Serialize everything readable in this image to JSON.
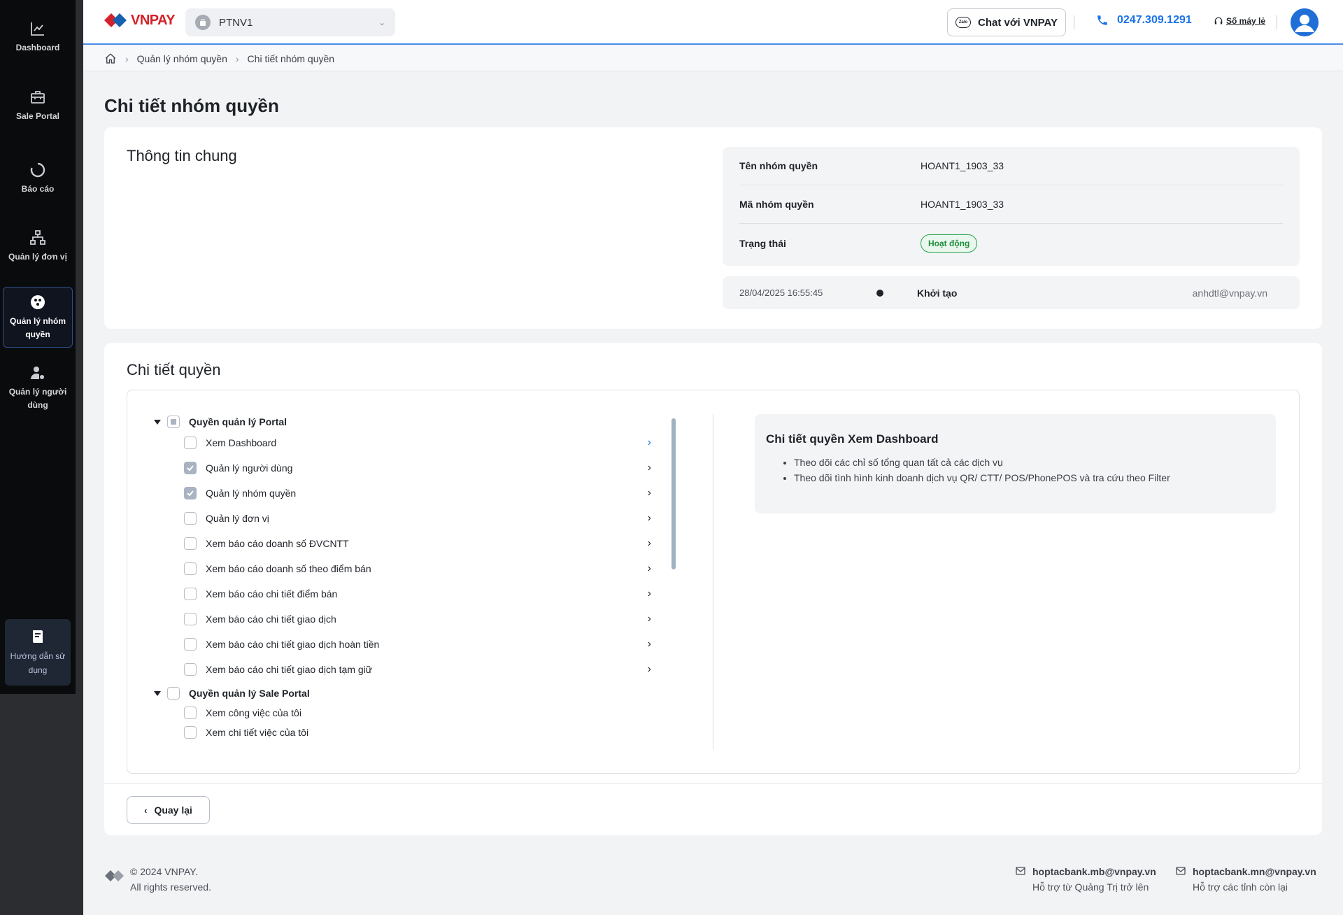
{
  "sidebar": {
    "items": [
      {
        "label": "Dashboard",
        "icon": "chart-line-icon"
      },
      {
        "label": "Sale Portal",
        "icon": "briefcase-icon"
      },
      {
        "label": "Báo cáo",
        "icon": "loading-circle-icon"
      },
      {
        "label": "Quản lý đơn vị",
        "icon": "hierarchy-icon"
      },
      {
        "label": "Quản lý nhóm quyền",
        "icon": "group-icon",
        "active": true
      },
      {
        "label": "Quản lý người dùng",
        "icon": "user-settings-icon"
      }
    ],
    "guide_label": "Hướng dẫn sử dụng"
  },
  "header": {
    "logo_text": "VNPAY",
    "merchant": "PTNV1",
    "chat_label": "Chat với VNPAY",
    "chat_badge": "Zalo",
    "hotline": "0247.309.1291",
    "retail_label": "Số máy lẻ"
  },
  "breadcrumb": {
    "items": [
      "Quản lý nhóm quyền",
      "Chi tiết nhóm quyền"
    ]
  },
  "page": {
    "title": "Chi tiết nhóm quyền"
  },
  "general": {
    "title": "Thông tin chung",
    "rows": [
      {
        "label": "Tên nhóm quyền",
        "value": "HOANT1_1903_33"
      },
      {
        "label": "Mã nhóm quyền",
        "value": "HOANT1_1903_33"
      },
      {
        "label": "Trạng thái",
        "value": "Hoạt động"
      }
    ],
    "status_color": "#2aa24b",
    "history": {
      "time": "28/04/2025 16:55:45",
      "action": "Khởi tạo",
      "user": "anhdtl@vnpay.vn"
    }
  },
  "detail": {
    "title": "Chi tiết quyền",
    "groups": [
      {
        "label": "Quyền quản lý Portal",
        "state": "partial",
        "items": [
          {
            "label": "Xem Dashboard",
            "checked": false,
            "selected": true
          },
          {
            "label": "Quản lý người dùng",
            "checked": true
          },
          {
            "label": "Quản lý nhóm quyền",
            "checked": true
          },
          {
            "label": "Quản lý đơn vị",
            "checked": false
          },
          {
            "label": "Xem báo cáo doanh số ĐVCNTT",
            "checked": false
          },
          {
            "label": "Xem báo cáo doanh số theo điểm bán",
            "checked": false
          },
          {
            "label": "Xem báo cáo chi tiết điểm bán",
            "checked": false
          },
          {
            "label": "Xem báo cáo chi tiết giao dịch",
            "checked": false
          },
          {
            "label": "Xem báo cáo chi tiết giao dịch hoàn tiền",
            "checked": false
          },
          {
            "label": "Xem báo cáo chi tiết giao dịch tạm giữ",
            "checked": false
          }
        ]
      },
      {
        "label": "Quyền quản lý Sale Portal",
        "state": "unchecked",
        "items": [
          {
            "label": "Xem công việc của tôi",
            "checked": false
          },
          {
            "label": "Xem chi tiết việc của tôi",
            "checked": false
          }
        ]
      }
    ],
    "description": {
      "title": "Chi tiết quyền Xem Dashboard",
      "points": [
        "Theo dõi các chỉ số tổng quan tất cả các dịch vụ",
        "Theo dõi tình hình kinh doanh dịch vụ QR/ CTT/ POS/PhonePOS và tra cứu theo Filter"
      ]
    },
    "back_label": "Quay lại"
  },
  "footer": {
    "copyright": "© 2024 VNPAY.",
    "rights": "All rights reserved.",
    "contacts": [
      {
        "email": "hoptacbank.mb@vnpay.vn",
        "note": "Hỗ trợ từ Quảng Trị trở lên"
      },
      {
        "email": "hoptacbank.mn@vnpay.vn",
        "note": "Hỗ trợ các tỉnh còn lại"
      }
    ]
  },
  "colors": {
    "accent": "#1a73e8",
    "sidebar_bg": "#0a0b0d",
    "brand_red": "#d3222a",
    "brand_blue": "#1760b0"
  }
}
